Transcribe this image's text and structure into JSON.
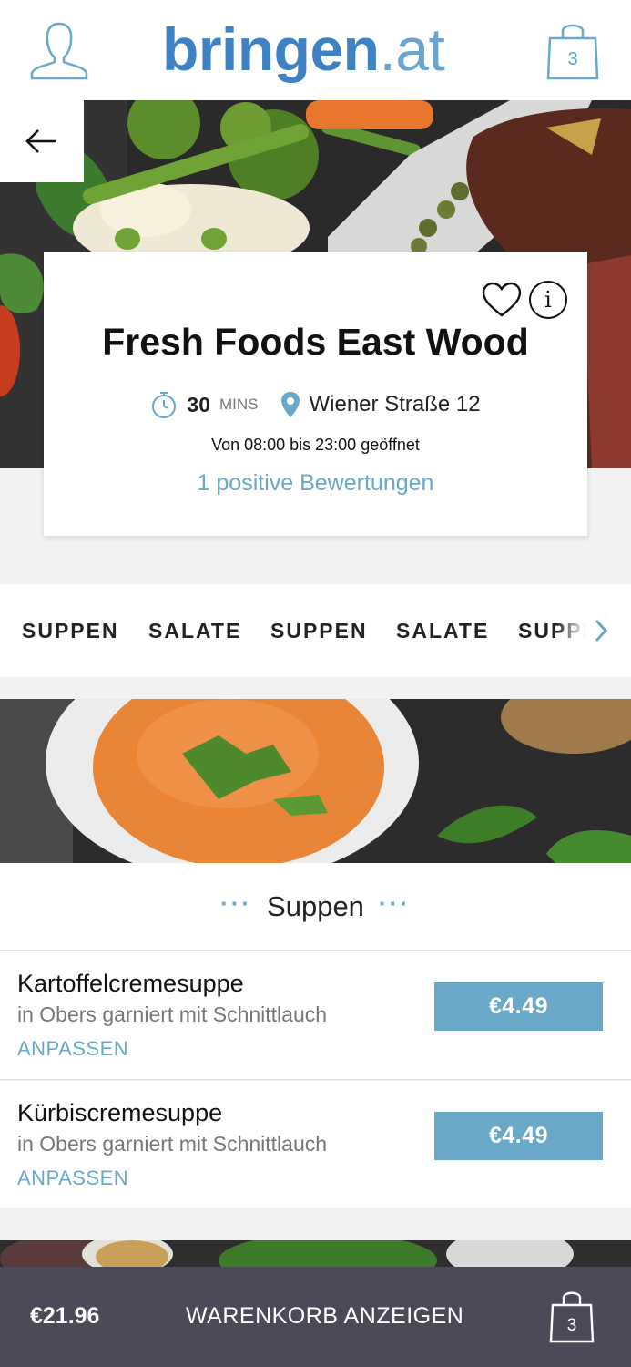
{
  "header": {
    "logo_part1": "bringen",
    "logo_dot": ".",
    "logo_part2": "at",
    "cart_count": "3"
  },
  "restaurant": {
    "name": "Fresh Foods East Wood",
    "delivery_time": "30",
    "delivery_unit": "MINS",
    "address": "Wiener Straße 12",
    "hours": "Von 08:00 bis 23:00 geöffnet",
    "reviews": "1 positive Bewertungen",
    "info_symbol": "i"
  },
  "categories": [
    "SUPPEN",
    "SALATE",
    "SUPPEN",
    "SALATE",
    "SUPPEN"
  ],
  "section": {
    "title": "Suppen",
    "dots": "···"
  },
  "items": [
    {
      "name": "Kartoffelcremesuppe",
      "description": "in Obers garniert mit Schnittlauch",
      "customize": "ANPASSEN",
      "price": "€4.49"
    },
    {
      "name": "Kürbiscremesuppe",
      "description": "in Obers garniert mit Schnittlauch",
      "customize": "ANPASSEN",
      "price": "€4.49"
    }
  ],
  "bottom_bar": {
    "total": "€21.96",
    "view_cart": "WARENKORB ANZEIGEN",
    "cart_count": "3"
  },
  "colors": {
    "brand_blue": "#3e82c4",
    "accent": "#6aa8c8",
    "bottom_bar": "#4a4a58"
  }
}
